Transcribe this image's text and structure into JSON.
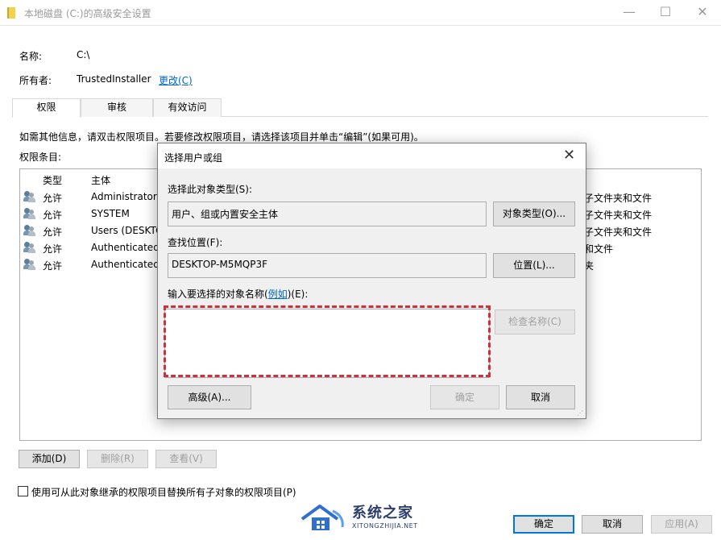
{
  "window": {
    "title": "本地磁盘 (C:)的高级安全设置",
    "minimize": "—",
    "maximize": "☐",
    "close": "✕"
  },
  "info": {
    "name_label": "名称:",
    "name_value": "C:\\",
    "owner_label": "所有者:",
    "owner_value": "TrustedInstaller",
    "change_link": "更改(C)"
  },
  "tabs": [
    "权限",
    "审核",
    "有效访问"
  ],
  "hint_text": "如需其他信息，请双击权限项目。若要修改权限项目，请选择该项目并单击“编辑”(如果可用)。",
  "entries_label": "权限条目:",
  "table": {
    "headers": [
      "类型",
      "主体"
    ],
    "rows": [
      {
        "type": "允许",
        "principal": "Administrators",
        "applies": "子文件夹和文件"
      },
      {
        "type": "允许",
        "principal": "SYSTEM",
        "applies": "子文件夹和文件"
      },
      {
        "type": "允许",
        "principal": "Users (DESKTC",
        "applies": "子文件夹和文件"
      },
      {
        "type": "允许",
        "principal": "Authenticated",
        "applies": "和文件"
      },
      {
        "type": "允许",
        "principal": "Authenticated",
        "applies": "夹"
      }
    ]
  },
  "buttons": {
    "add": "添加(D)",
    "remove": "删除(R)",
    "view": "查看(V)",
    "ok": "确定",
    "cancel": "取消",
    "apply": "应用(A)"
  },
  "inherit_checkbox": "使用可从此对象继承的权限项目替换所有子对象的权限项目(P)",
  "dialog": {
    "title": "选择用户或组",
    "close": "✕",
    "object_type_label": "选择此对象类型(S):",
    "object_type_value": "用户、组或内置安全主体",
    "object_type_button": "对象类型(O)...",
    "location_label": "查找位置(F):",
    "location_value": "DESKTOP-M5MQP3F",
    "location_button": "位置(L)...",
    "enter_label_prefix": "输入要选择的对象名称(",
    "enter_label_link": "例如",
    "enter_label_suffix": ")(E):",
    "object_name_value": "",
    "check_names_button": "检查名称(C)",
    "advanced_button": "高级(A)...",
    "ok_button": "确定",
    "cancel_button": "取消"
  },
  "watermark": {
    "title": "系统之家",
    "subtitle": "XITONGZHIJIA.NET"
  },
  "colors": {
    "link": "#0066cc",
    "highlight_dash": "#d0303c",
    "primary_border": "#0078d7"
  }
}
